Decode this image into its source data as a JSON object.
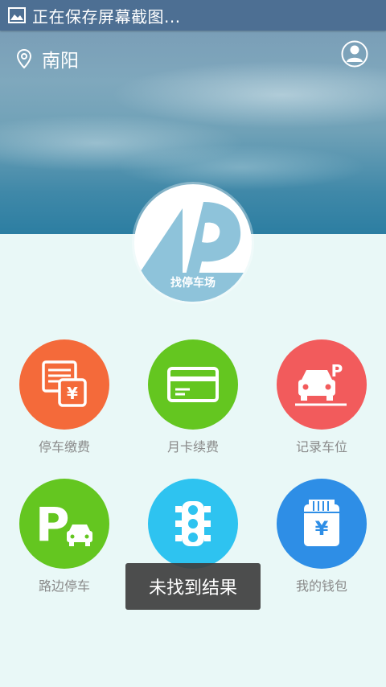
{
  "status_bar": {
    "text": "正在保存屏幕截图..."
  },
  "header": {
    "city": "南阳"
  },
  "find_parking": {
    "label": "找停车场"
  },
  "grid": {
    "items": [
      {
        "label": "停车缴费",
        "icon": "bill-yuan-icon",
        "color": "#f46a3a"
      },
      {
        "label": "月卡续费",
        "icon": "card-icon",
        "color": "#64c620"
      },
      {
        "label": "记录车位",
        "icon": "car-p-icon",
        "color": "#f25b5c"
      },
      {
        "label": "路边停车",
        "icon": "parking-car-icon",
        "color": "#64c620"
      },
      {
        "label": "",
        "icon": "traffic-light-icon",
        "color": "#2ec3f0"
      },
      {
        "label": "我的钱包",
        "icon": "wallet-icon",
        "color": "#2e8ee6"
      }
    ]
  },
  "toast": {
    "text": "未找到结果"
  }
}
